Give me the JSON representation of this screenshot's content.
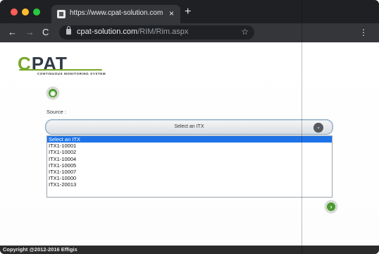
{
  "browser": {
    "tab_title": "https://www.cpat-solution.com",
    "tab_close": "×",
    "new_tab": "+",
    "back": "←",
    "forward": "→",
    "reload": "C",
    "url_host": "cpat-solution.com",
    "url_path": "/RIM/Rim.aspx",
    "star": "☆",
    "menu": "⋮"
  },
  "logo": {
    "main_c": "C",
    "main_rest": "PAT",
    "subtitle": "CONTINUOUS MONITORING SYSTEM"
  },
  "home_button": {
    "glyph": "◉"
  },
  "next_button": {
    "glyph": "›"
  },
  "source": {
    "label": "Source :",
    "selected_value": "Select an ITX",
    "chevron": "⌄",
    "options": [
      "Select an ITX",
      "ITX1-10001",
      "ITX1-10002",
      "ITX1-10004",
      "ITX1-10005",
      "ITX1-10007",
      "ITX1-10000",
      "ITX1-20013"
    ]
  },
  "footer": {
    "copyright": "Copyright @2012-2016 Effigis"
  },
  "colors": {
    "brand_green": "#78a82a",
    "button_green": "#4a9a2c",
    "selection_blue": "#1e73e8",
    "chrome_dark": "#35363a"
  }
}
